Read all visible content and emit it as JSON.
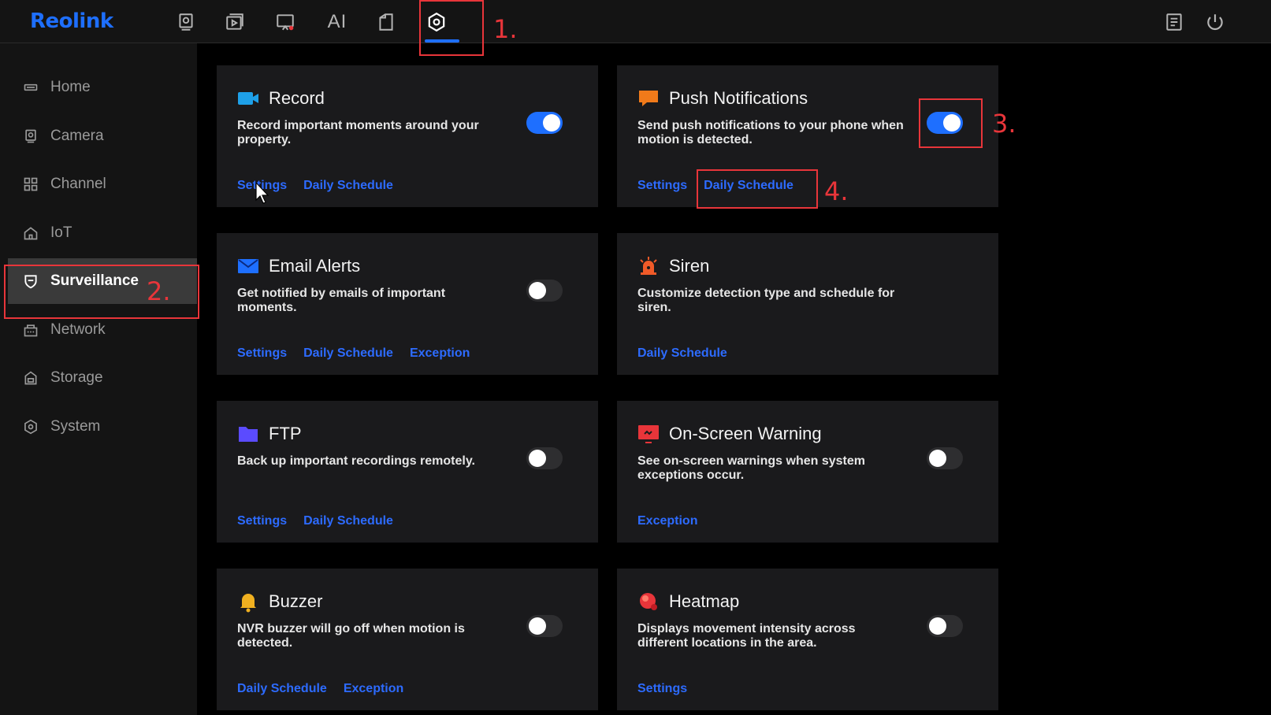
{
  "brand": {
    "logo_text": "Reolink",
    "accent_color": "#1e6fff"
  },
  "topnav": {
    "icons": [
      "preview-icon",
      "playback-icon",
      "alarm-icon",
      "ai-icon",
      "files-icon",
      "settings-icon"
    ],
    "ai_label": "AI",
    "active": "settings-icon",
    "right_icons": [
      "notes-icon",
      "power-icon"
    ]
  },
  "sidebar": {
    "items": [
      {
        "label": "Home",
        "icon": "home-icon"
      },
      {
        "label": "Camera",
        "icon": "camera-icon"
      },
      {
        "label": "Channel",
        "icon": "channel-icon"
      },
      {
        "label": "IoT",
        "icon": "iot-icon"
      },
      {
        "label": "Surveillance",
        "icon": "shield-icon",
        "active": true
      },
      {
        "label": "Network",
        "icon": "network-icon"
      },
      {
        "label": "Storage",
        "icon": "storage-icon"
      },
      {
        "label": "System",
        "icon": "system-icon"
      }
    ]
  },
  "cards": [
    {
      "title": "Record",
      "icon": "video-icon",
      "icon_color": "#1ea0e8",
      "description": "Record important moments around your property.",
      "toggle": true,
      "links": [
        "Settings",
        "Daily Schedule"
      ]
    },
    {
      "title": "Push Notifications",
      "icon": "message-icon",
      "icon_color": "#f07a1a",
      "description": "Send push notifications to your phone when motion is detected.",
      "toggle": true,
      "links": [
        "Settings",
        "Daily Schedule"
      ]
    },
    {
      "title": "Email Alerts",
      "icon": "mail-icon",
      "icon_color": "#1e6fff",
      "description": "Get notified by emails of important moments.",
      "toggle": false,
      "links": [
        "Settings",
        "Daily Schedule",
        "Exception"
      ]
    },
    {
      "title": "Siren",
      "icon": "siren-icon",
      "icon_color": "#f05a28",
      "description": "Customize detection type and schedule for siren.",
      "toggle": null,
      "links": [
        "Daily Schedule"
      ]
    },
    {
      "title": "FTP",
      "icon": "folder-icon",
      "icon_color": "#5b4bff",
      "description": "Back up important recordings remotely.",
      "toggle": false,
      "links": [
        "Settings",
        "Daily Schedule"
      ]
    },
    {
      "title": "On-Screen Warning",
      "icon": "screen-warning-icon",
      "icon_color": "#e8353a",
      "description": "See on-screen warnings when system exceptions occur.",
      "toggle": false,
      "links": [
        "Exception"
      ]
    },
    {
      "title": "Buzzer",
      "icon": "bell-icon",
      "icon_color": "#f0b020",
      "description": "NVR buzzer will go off when motion is detected.",
      "toggle": false,
      "links": [
        "Daily Schedule",
        "Exception"
      ]
    },
    {
      "title": "Heatmap",
      "icon": "heatmap-icon",
      "icon_color": "#e8353a",
      "description": "Displays movement intensity across different locations in the area.",
      "toggle": false,
      "links": [
        "Settings"
      ]
    }
  ],
  "annotations": [
    "1.",
    "2.",
    "3.",
    "4."
  ],
  "annotation_color": "#e8353a"
}
